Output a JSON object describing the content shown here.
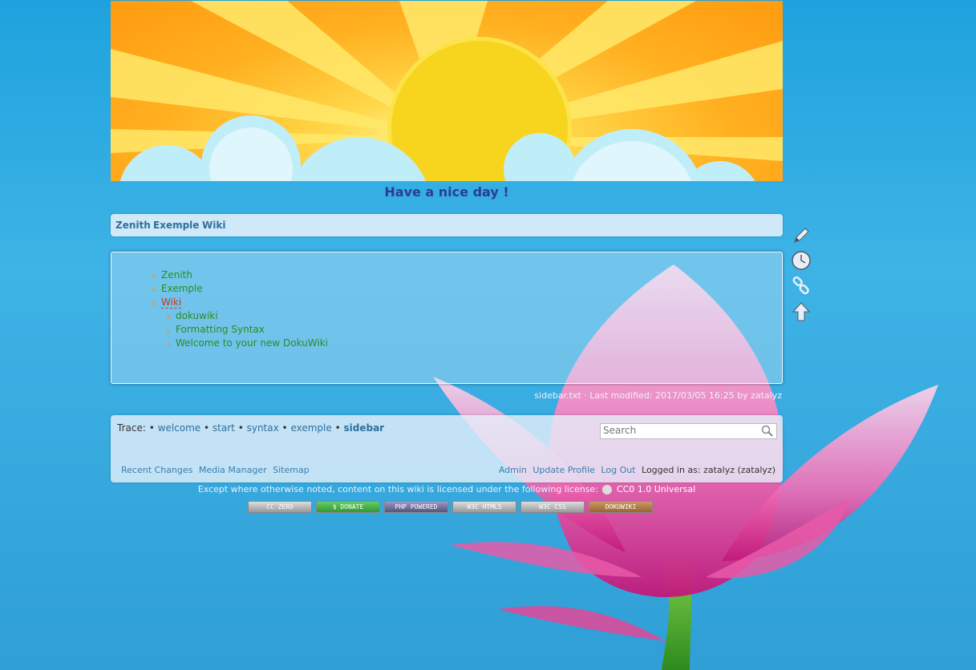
{
  "header": {
    "tagline": "Have a nice day !"
  },
  "menu": [
    "Zenith",
    "Exemple",
    "Wiki"
  ],
  "sidebar_list": {
    "items": [
      "Zenith",
      "Exemple",
      "Wiki"
    ],
    "subitems": [
      "dokuwiki",
      "Formatting Syntax",
      "Welcome to your new DokuWiki"
    ]
  },
  "pageinfo": "sidebar.txt · Last modified: 2017/03/05 16:25 by zatalyz",
  "trace": {
    "label": "Trace:",
    "items": [
      "welcome",
      "start",
      "syntax",
      "exemple",
      "sidebar"
    ]
  },
  "search": {
    "placeholder": "Search"
  },
  "footer_links_left": [
    "Recent Changes",
    "Media Manager",
    "Sitemap"
  ],
  "footer_links_right": [
    "Admin",
    "Update Profile",
    "Log Out"
  ],
  "logged_in": "Logged in as: zatalyz (zatalyz)",
  "license": {
    "text": "Except where otherwise noted, content on this wiki is licensed under the following license:",
    "link": "CC0 1.0 Universal"
  },
  "badges": [
    "CC ZERO",
    "$ DONATE",
    "PHP POWERED",
    "W3C HTML5",
    "W3C CSS",
    "DOKUWIKI"
  ],
  "tools": [
    "edit-icon",
    "history-icon",
    "backlinks-icon",
    "top-icon"
  ],
  "colors": {
    "menu_link": "#2e6f9e",
    "list_link": "#2e8b1e",
    "tagline": "#2d3b96"
  }
}
